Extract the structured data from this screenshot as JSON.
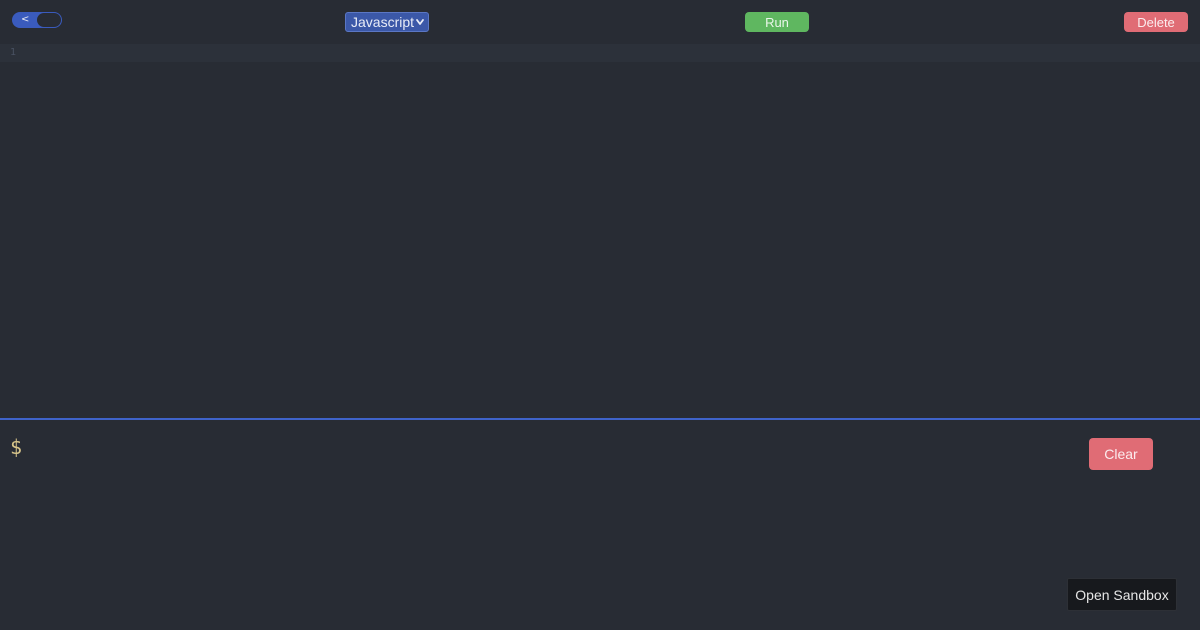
{
  "toolbar": {
    "toggle_arrow": "<",
    "language": {
      "selected": "Javascript",
      "chevron_icon": "chevron-down-icon"
    },
    "run_label": "Run",
    "delete_label": "Delete"
  },
  "editor": {
    "line_numbers": [
      "1"
    ],
    "content": ""
  },
  "terminal": {
    "prompt": "$",
    "clear_label": "Clear",
    "open_sandbox_label": "Open Sandbox"
  },
  "colors": {
    "background": "#282c34",
    "active_line": "#2c313a",
    "accent_blue": "#3f63c9",
    "run_green": "#5fb760",
    "danger_red": "#e06c75",
    "prompt_yellow": "#d7c48a"
  }
}
